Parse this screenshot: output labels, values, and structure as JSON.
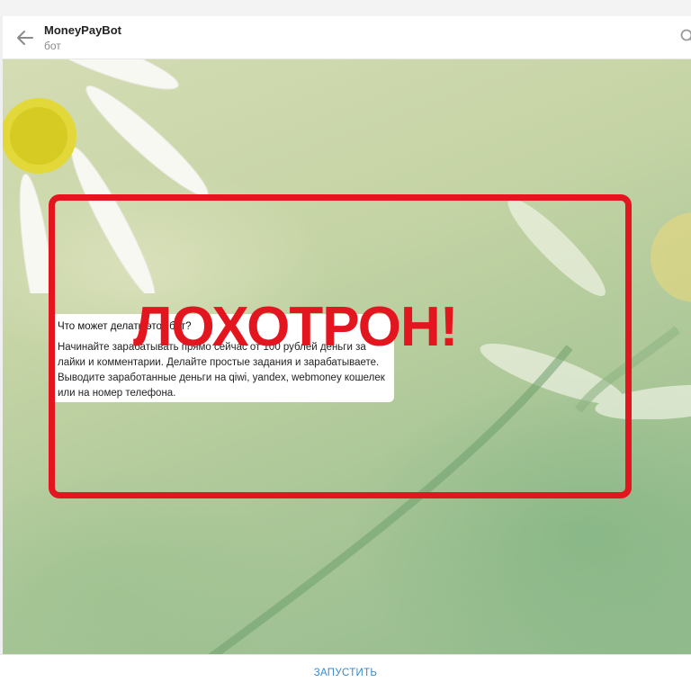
{
  "header": {
    "title": "MoneyPayBot",
    "subtitle": "бот",
    "back_icon": "arrow-left-icon",
    "search_icon": "search-icon"
  },
  "info_card": {
    "title": "Что может делать этот бот?",
    "text": "Начинайте зарабатывать прямо сейчас от 100 рублей деньги за лайки и комментарии. Делайте простые задания и зарабатываете. Выводите заработанные деньги на qiwi, yandex, webmoney кошелек или на номер телефона."
  },
  "stamp": {
    "text": "ЛОХОТРОН!",
    "color": "#e3161f"
  },
  "footer": {
    "start_label": "ЗАПУСТИТЬ"
  },
  "colors": {
    "accent": "#3a8ac8",
    "stamp": "#e3161f"
  }
}
